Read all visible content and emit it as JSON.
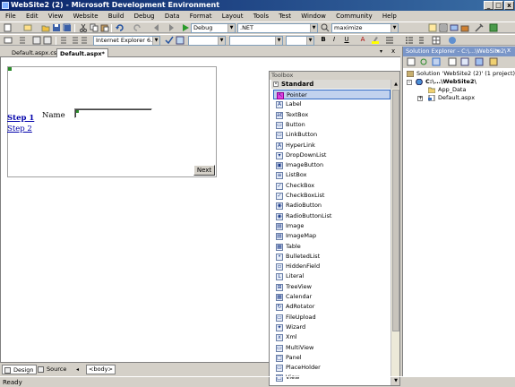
{
  "window": {
    "title": "WebSite2 (2) - Microsoft Development Environment",
    "minimize_label": "_",
    "maximize_label": "□",
    "close_label": "x"
  },
  "menu": [
    "File",
    "Edit",
    "View",
    "Website",
    "Build",
    "Debug",
    "Data",
    "Format",
    "Layout",
    "Tools",
    "Test",
    "Window",
    "Community",
    "Help"
  ],
  "toolbar1": {
    "config_combo": "Debug",
    "platform_combo": ".NET",
    "find_combo": "maximize"
  },
  "toolbar2": {
    "target_browser": "Internet Explorer 6.0",
    "bold": "B",
    "italic": "I",
    "underline": "U",
    "font_color": "A"
  },
  "document_tabs": [
    {
      "label": "Default.aspx.cs*",
      "active": false
    },
    {
      "label": "Default.aspx*",
      "active": true
    }
  ],
  "designer": {
    "steps": [
      "Step 1",
      "Step 2"
    ],
    "name_label": "Name",
    "next_button": "Next"
  },
  "view_tabs": {
    "design": "Design",
    "source": "Source",
    "tag": "<body>"
  },
  "status": "Ready",
  "toolbox": {
    "title": "Toolbox",
    "section": "Standard",
    "items": [
      {
        "label": "Pointer",
        "icon": "pointer-icon",
        "glyph": "↖"
      },
      {
        "label": "Label",
        "icon": "label-icon",
        "glyph": "A"
      },
      {
        "label": "TextBox",
        "icon": "textbox-icon",
        "glyph": "ab"
      },
      {
        "label": "Button",
        "icon": "button-icon",
        "glyph": "▭"
      },
      {
        "label": "LinkButton",
        "icon": "linkbutton-icon",
        "glyph": "▭"
      },
      {
        "label": "HyperLink",
        "icon": "hyperlink-icon",
        "glyph": "A"
      },
      {
        "label": "DropDownList",
        "icon": "dropdownlist-icon",
        "glyph": "▾"
      },
      {
        "label": "ImageButton",
        "icon": "imagebutton-icon",
        "glyph": "▣"
      },
      {
        "label": "ListBox",
        "icon": "listbox-icon",
        "glyph": "≡"
      },
      {
        "label": "CheckBox",
        "icon": "checkbox-icon",
        "glyph": "✓"
      },
      {
        "label": "CheckBoxList",
        "icon": "checkboxlist-icon",
        "glyph": "✓"
      },
      {
        "label": "RadioButton",
        "icon": "radiobutton-icon",
        "glyph": "◉"
      },
      {
        "label": "RadioButtonList",
        "icon": "radiobuttonlist-icon",
        "glyph": "◉"
      },
      {
        "label": "Image",
        "icon": "image-icon",
        "glyph": "▤"
      },
      {
        "label": "ImageMap",
        "icon": "imagemap-icon",
        "glyph": "▤"
      },
      {
        "label": "Table",
        "icon": "table-icon",
        "glyph": "▦"
      },
      {
        "label": "BulletedList",
        "icon": "bulletedlist-icon",
        "glyph": "•"
      },
      {
        "label": "HiddenField",
        "icon": "hiddenfield-icon",
        "glyph": "▫"
      },
      {
        "label": "Literal",
        "icon": "literal-icon",
        "glyph": "L"
      },
      {
        "label": "TreeView",
        "icon": "treeview-icon",
        "glyph": "⊞"
      },
      {
        "label": "Calendar",
        "icon": "calendar-icon",
        "glyph": "▦"
      },
      {
        "label": "AdRotator",
        "icon": "adrotator-icon",
        "glyph": "↻"
      },
      {
        "label": "FileUpload",
        "icon": "fileupload-icon",
        "glyph": "▭"
      },
      {
        "label": "Wizard",
        "icon": "wizard-icon",
        "glyph": "✦"
      },
      {
        "label": "Xml",
        "icon": "xml-icon",
        "glyph": "x"
      },
      {
        "label": "MultiView",
        "icon": "multiview-icon",
        "glyph": "▭"
      },
      {
        "label": "Panel",
        "icon": "panel-icon",
        "glyph": "□"
      },
      {
        "label": "PlaceHolder",
        "icon": "placeholder-icon",
        "glyph": "▭"
      },
      {
        "label": "View",
        "icon": "view-icon",
        "glyph": "□"
      }
    ]
  },
  "solution_explorer": {
    "title": "Solution Explorer - C:\\...\\WebSite2\\",
    "tree": [
      {
        "label": "Solution 'WebSite2 (2)' (1 project)",
        "icon": "solution-icon"
      },
      {
        "label": "C:\\...\\WebSite2\\",
        "icon": "website-icon"
      },
      {
        "label": "App_Data",
        "icon": "folder-icon"
      },
      {
        "label": "Default.aspx",
        "icon": "aspx-file-icon"
      }
    ]
  },
  "colors": {
    "title_bar": "#0a246a",
    "chrome": "#d4d0c8",
    "link": "#0000aa",
    "selection": "#c1d2ee",
    "panel_header": "#7a96c8"
  }
}
